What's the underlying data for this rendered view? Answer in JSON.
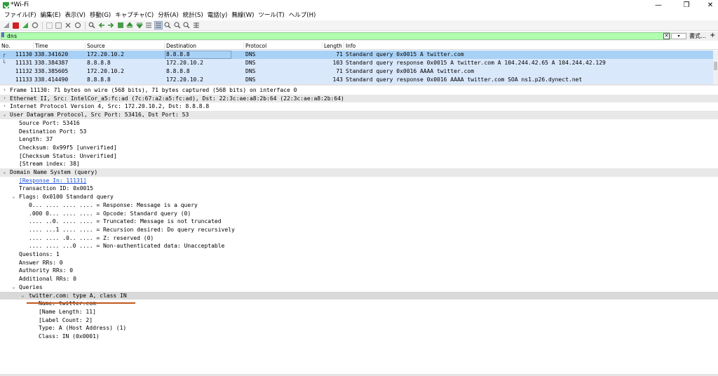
{
  "window": {
    "title": "*Wi-Fi",
    "minimize": "—",
    "restore": "❐",
    "close": "✕"
  },
  "menu": [
    "ファイル(F)",
    "編集(E)",
    "表示(V)",
    "移動(G)",
    "キャプチャ(C)",
    "分析(A)",
    "統計(S)",
    "電話(y)",
    "無線(W)",
    "ツール(T)",
    "ヘルプ(H)"
  ],
  "colors": {
    "filter_ok": "#afffaf",
    "row_bg": "#dae8fc",
    "row_selected": "#a9d1f5",
    "link": "#1a4fd6",
    "annotation_underline": "#c0561a"
  },
  "filter": {
    "value": "dns",
    "expression_label": "書式…",
    "add_label": "+"
  },
  "columns": [
    "No.",
    "Time",
    "Source",
    "Destination",
    "Protocol",
    "Length",
    "Info"
  ],
  "packets": [
    {
      "no": "11130",
      "time": "338.341620",
      "source": "172.20.10.2",
      "destination": "8.8.8.8",
      "protocol": "DNS",
      "length": "71",
      "info": "Standard query 0x0015 A twitter.com",
      "selected": true
    },
    {
      "no": "11131",
      "time": "338.384387",
      "source": "8.8.8.8",
      "destination": "172.20.10.2",
      "protocol": "DNS",
      "length": "103",
      "info": "Standard query response 0x0015 A twitter.com A 104.244.42.65 A 104.244.42.129"
    },
    {
      "no": "11132",
      "time": "338.385605",
      "source": "172.20.10.2",
      "destination": "8.8.8.8",
      "protocol": "DNS",
      "length": "71",
      "info": "Standard query 0x0016 AAAA twitter.com"
    },
    {
      "no": "11133",
      "time": "338.414490",
      "source": "8.8.8.8",
      "destination": "172.20.10.2",
      "protocol": "DNS",
      "length": "143",
      "info": "Standard query response 0x0016 AAAA twitter.com SOA ns1.p26.dynect.net"
    }
  ],
  "details": [
    {
      "text": "Frame 11130: 71 bytes on wire (568 bits), 71 bytes captured (568 bits) on interface 0",
      "arrow": "›"
    },
    {
      "text": "Ethernet II, Src: IntelCor_a5:fc:ad (7c:67:a2:a5:fc:ad), Dst: 22:3c:ae:a8:2b:64 (22:3c:ae:a8:2b:64)",
      "arrow": "›"
    },
    {
      "text": "Internet Protocol Version 4, Src: 172.20.10.2, Dst: 8.8.8.8",
      "arrow": "›"
    },
    {
      "text": "User Datagram Protocol, Src Port: 53416, Dst Port: 53",
      "arrow": "⌄"
    },
    {
      "text": "Source Port: 53416"
    },
    {
      "text": "Destination Port: 53"
    },
    {
      "text": "Length: 37"
    },
    {
      "text": "Checksum: 0x99f5 [unverified]"
    },
    {
      "text": "[Checksum Status: Unverified]"
    },
    {
      "text": "[Stream index: 38]"
    },
    {
      "text": "Domain Name System (query)",
      "arrow": "⌄"
    },
    {
      "text": "[Response In: 11131]"
    },
    {
      "text": "Transaction ID: 0x0015"
    },
    {
      "text": "Flags: 0x0100 Standard query",
      "arrow": "⌄"
    },
    {
      "text": "0... .... .... .... = Response: Message is a query"
    },
    {
      "text": ".000 0... .... .... = Opcode: Standard query (0)"
    },
    {
      "text": ".... ..0. .... .... = Truncated: Message is not truncated"
    },
    {
      "text": ".... ...1 .... .... = Recursion desired: Do query recursively"
    },
    {
      "text": ".... .... .0.. .... = Z: reserved (0)"
    },
    {
      "text": ".... .... ...0 .... = Non-authenticated data: Unacceptable"
    },
    {
      "text": "Questions: 1"
    },
    {
      "text": "Answer RRs: 0"
    },
    {
      "text": "Authority RRs: 0"
    },
    {
      "text": "Additional RRs: 0"
    },
    {
      "text": "Queries",
      "arrow": "⌄"
    },
    {
      "text": "twitter.com: type A, class IN",
      "arrow": "⌄"
    },
    {
      "text": "Name: twitter.com"
    },
    {
      "text": "[Name Length: 11]"
    },
    {
      "text": "[Label Count: 2]"
    },
    {
      "text": "Type: A (Host Address) (1)"
    },
    {
      "text": "Class: IN (0x0001)"
    }
  ],
  "toolbar_icons": [
    "shark-fin-start-icon",
    "stop-capture-icon",
    "restart-capture-icon",
    "capture-options-icon",
    "open-file-icon",
    "save-file-icon",
    "close-file-icon",
    "reload-icon",
    "find-packet-icon",
    "go-back-icon",
    "go-forward-icon",
    "go-to-packet-icon",
    "go-first-icon",
    "go-last-icon",
    "auto-scroll-icon",
    "colorize-icon",
    "zoom-in-icon",
    "zoom-out-icon",
    "zoom-normal-icon",
    "resize-columns-icon"
  ]
}
